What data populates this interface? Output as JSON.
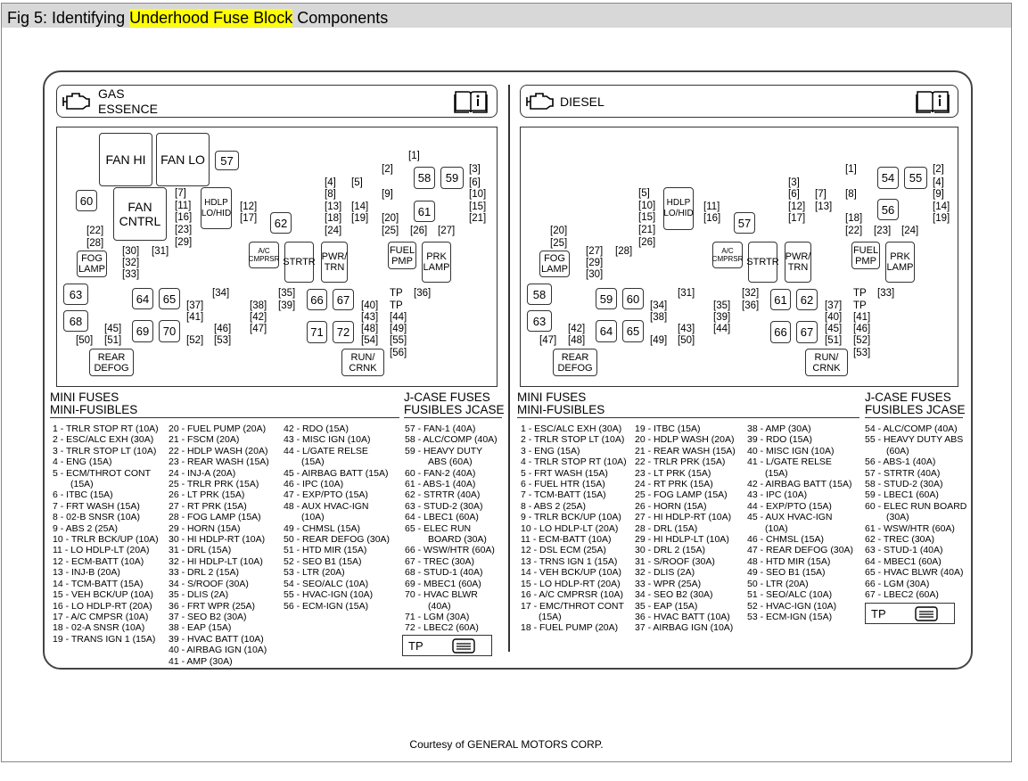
{
  "figure_title": {
    "prefix": "Fig 5: Identifying",
    "highlight": "Underhood Fuse Block",
    "suffix": "Components"
  },
  "gas": {
    "label_line1": "GAS",
    "label_line2": "ESSENCE",
    "mini_fuses_heading": [
      "MINI FUSES",
      "MINI-FUSIBLES"
    ],
    "jcase_heading": [
      "J-CASE FUSES",
      "FUSIBLES JCASE"
    ],
    "mini_col1": [
      "1 - TRLR STOP RT (10A)",
      "2 - ESC/ALC EXH (30A)",
      "3 - TRLR STOP LT (10A)",
      "4 - ENG (15A)",
      "5 - ECM/THROT CONT",
      "(15A)",
      "6 - ITBC (15A)",
      "7 - FRT WASH (15A)",
      "8 - 02-B SNSR (10A)",
      "9 - ABS 2 (25A)",
      "10 - TRLR BCK/UP (10A)",
      "11 - LO HDLP-LT (20A)",
      "12 - ECM-BATT (10A)",
      "13 - INJ-B (20A)",
      "14 - TCM-BATT (15A)",
      "15 - VEH BCK/UP (10A)",
      "16 - LO HDLP-RT (20A)",
      "17 - A/C CMPSR (10A)",
      "18 - 02-A SNSR (10A)",
      "19 - TRANS IGN 1 (15A)"
    ],
    "mini_col2": [
      "20 - FUEL PUMP (20A)",
      "21 - FSCM (20A)",
      "22 - HDLP WASH (20A)",
      "23 - REAR WASH (15A)",
      "24 - INJ-A (20A)",
      "25 - TRLR PRK (15A)",
      "26 - LT PRK (15A)",
      "27 - RT PRK (15A)",
      "28 - FOG LAMP (15A)",
      "29 - HORN (15A)",
      "30 - HI HDLP-RT (10A)",
      "31 - DRL (15A)",
      "32 - HI HDLP-LT (10A)",
      "33 - DRL 2 (15A)",
      "34 - S/ROOF (30A)",
      "35 - DLIS (2A)",
      "36 - FRT WPR (25A)",
      "37 - SEO B2 (30A)",
      "38 - EAP (15A)",
      "39 - HVAC BATT (10A)",
      "40 - AIRBAG IGN (10A)",
      "41 - AMP (30A)"
    ],
    "mini_col3": [
      "42 - RDO (15A)",
      "43 - MISC IGN (10A)",
      "44 - L/GATE RELSE",
      "(15A)",
      "45 - AIRBAG BATT (15A)",
      "46 - IPC (10A)",
      "47 - EXP/PTO (15A)",
      "48 - AUX HVAC-IGN",
      "(10A)",
      "49 - CHMSL (15A)",
      "50 - REAR DEFOG (30A)",
      "51 - HTD MIR (15A)",
      "52 - SEO B1 (15A)",
      "53 - LTR (20A)",
      "54 - SEO/ALC (10A)",
      "55 - HVAC-IGN (10A)",
      "56 - ECM-IGN (15A)"
    ],
    "jcase_col": [
      "57 - FAN-1 (40A)",
      "58 - ALC/COMP (40A)",
      "59 - HEAVY DUTY",
      "ABS (60A)",
      "60 - FAN-2 (40A)",
      "61 - ABS-1 (40A)",
      "62 - STRTR (40A)",
      "63 - STUD-2 (30A)",
      "64 - LBEC1 (60A)",
      "65 - ELEC RUN",
      "BOARD (30A)",
      "66 - WSW/HTR (60A)",
      "67 - TREC (30A)",
      "68 - STUD-1 (40A)",
      "69 - MBEC1 (60A)",
      "70 - HVAC BLWR",
      "(40A)",
      "71 - LGM (30A)",
      "72 - LBEC2 (60A)"
    ],
    "tp_label": "TP",
    "fuses": [
      {
        "t": "FAN HI"
      },
      {
        "t": "FAN LO"
      },
      {
        "t": "57"
      },
      {
        "t": "60"
      },
      {
        "t": "FAN CNTRL"
      },
      {
        "t": "HDLP LO/HID"
      },
      {
        "t": "62"
      },
      {
        "t": "58"
      },
      {
        "t": "59"
      },
      {
        "t": "61"
      },
      {
        "t": "A/C CMPRSR"
      },
      {
        "t": "STRTR"
      },
      {
        "t": "PWR/ TRN"
      },
      {
        "t": "FUEL PMP"
      },
      {
        "t": "PRK LAMP"
      },
      {
        "t": "FOG LAMP"
      },
      {
        "t": "63"
      },
      {
        "t": "68"
      },
      {
        "t": "64"
      },
      {
        "t": "65"
      },
      {
        "t": "69"
      },
      {
        "t": "70"
      },
      {
        "t": "66"
      },
      {
        "t": "67"
      },
      {
        "t": "71"
      },
      {
        "t": "72"
      },
      {
        "t": "REAR DEFOG"
      },
      {
        "t": "RUN/ CRNK"
      }
    ],
    "labels": [
      "[1]",
      "[2]",
      "[3]",
      "[4]",
      "[5]",
      "[6]",
      "[7]",
      "[8]",
      "[9]",
      "[10]",
      "[11]",
      "[12]",
      "[13]",
      "[14]",
      "[15]",
      "[16]",
      "[17]",
      "[18]",
      "[19]",
      "[20]",
      "[21]",
      "[22]",
      "[23]",
      "[24]",
      "[25]",
      "[26]",
      "[27]",
      "[28]",
      "[29]",
      "[30]",
      "[31]",
      "[32]",
      "[33]",
      "[34]",
      "[35]",
      "[36]",
      "[37]",
      "[38]",
      "[39]",
      "[40]",
      "[41]",
      "[42]",
      "[43]",
      "[44]",
      "[45]",
      "[46]",
      "[47]",
      "[48]",
      "[49]",
      "[50]",
      "[51]",
      "[52]",
      "[53]",
      "[54]",
      "[55]",
      "[56]",
      "TP"
    ]
  },
  "diesel": {
    "label": "DIESEL",
    "mini_fuses_heading": [
      "MINI FUSES",
      "MINI-FUSIBLES"
    ],
    "jcase_heading": [
      "J-CASE FUSES",
      "FUSIBLES JCASE"
    ],
    "mini_col1": [
      "1 - ESC/ALC EXH (30A)",
      "2 - TRLR STOP LT (10A)",
      "3 - ENG (15A)",
      "4 - TRLR STOP RT (10A)",
      "5 - FRT WASH (15A)",
      "6 - FUEL HTR (15A)",
      "7 - TCM-BATT (15A)",
      "8 - ABS 2 (25A)",
      "9 - TRLR BCK/UP (10A)",
      "10 - LO HDLP-LT (20A)",
      "11 - ECM-BATT (10A)",
      "12 - DSL ECM (25A)",
      "13 - TRNS IGN 1 (15A)",
      "14 - VEH BCK/UP (10A)",
      "15 - LO HDLP-RT (20A)",
      "16 - A/C CMPRSR (10A)",
      "17 - EMC/THROT CONT",
      "(15A)",
      "18 - FUEL PUMP (20A)"
    ],
    "mini_col2": [
      "19 - ITBC (15A)",
      "20 - HDLP WASH (20A)",
      "21 - REAR WASH (15A)",
      "22 - TRLR PRK (15A)",
      "23 - LT PRK (15A)",
      "24 - RT PRK (15A)",
      "25 - FOG LAMP (15A)",
      "26 - HORN (15A)",
      "27 - HI HDLP-RT (10A)",
      "28 - DRL (15A)",
      "29 - HI HDLP-LT (10A)",
      "30 - DRL 2 (15A)",
      "31 - S/ROOF (30A)",
      "32 - DLIS (2A)",
      "33 - WPR (25A)",
      "34 - SEO B2 (30A)",
      "35 - EAP (15A)",
      "36 - HVAC BATT (10A)",
      "37 - AIRBAG IGN (10A)"
    ],
    "mini_col3": [
      "38 - AMP (30A)",
      "39 - RDO (15A)",
      "40 - MISC IGN (10A)",
      "41 - L/GATE RELSE",
      "(15A)",
      "42 - AIRBAG BATT (15A)",
      "43 - IPC (10A)",
      "44 - EXP/PTO (15A)",
      "45 - AUX HVAC-IGN",
      "(10A)",
      "46 - CHMSL (15A)",
      "47 - REAR DEFOG (30A)",
      "48 - HTD MIR (15A)",
      "49 - SEO B1 (15A)",
      "50 - LTR (20A)",
      "51 - SEO/ALC (10A)",
      "52 - HVAC-IGN (10A)",
      "53 - ECM-IGN (15A)"
    ],
    "jcase_col": [
      "54 - ALC/COMP (40A)",
      "55 - HEAVY DUTY ABS",
      "(60A)",
      "56 - ABS-1 (40A)",
      "57 - STRTR (40A)",
      "58 - STUD-2 (30A)",
      "59 - LBEC1 (60A)",
      "60 - ELEC RUN BOARD",
      "(30A)",
      "61 - WSW/HTR (60A)",
      "62 - TREC (30A)",
      "63 - STUD-1 (40A)",
      "64 - MBEC1 (60A)",
      "65 - HVAC BLWR (40A)",
      "66 - LGM (30A)",
      "67 - LBEC2 (60A)"
    ],
    "tp_label": "TP",
    "fuses": [
      {
        "t": "HDLP LO/HID"
      },
      {
        "t": "57"
      },
      {
        "t": "54"
      },
      {
        "t": "55"
      },
      {
        "t": "56"
      },
      {
        "t": "A/C CMPRSR"
      },
      {
        "t": "STRTR"
      },
      {
        "t": "PWR/ TRN"
      },
      {
        "t": "FUEL PMP"
      },
      {
        "t": "PRK LAMP"
      },
      {
        "t": "FOG LAMP"
      },
      {
        "t": "58"
      },
      {
        "t": "59"
      },
      {
        "t": "60"
      },
      {
        "t": "61"
      },
      {
        "t": "62"
      },
      {
        "t": "63"
      },
      {
        "t": "64"
      },
      {
        "t": "65"
      },
      {
        "t": "66"
      },
      {
        "t": "67"
      },
      {
        "t": "REAR DEFOG"
      },
      {
        "t": "RUN/ CRNK"
      }
    ],
    "labels": [
      "[1]",
      "[2]",
      "[3]",
      "[4]",
      "[5]",
      "[6]",
      "[7]",
      "[8]",
      "[9]",
      "[10]",
      "[11]",
      "[12]",
      "[13]",
      "[14]",
      "[15]",
      "[16]",
      "[17]",
      "[18]",
      "[19]",
      "[20]",
      "[21]",
      "[22]",
      "[23]",
      "[24]",
      "[25]",
      "[26]",
      "[27]",
      "[28]",
      "[29]",
      "[30]",
      "[31]",
      "[32]",
      "[33]",
      "[34]",
      "[35]",
      "[36]",
      "[37]",
      "[38]",
      "[39]",
      "[40]",
      "[41]",
      "[42]",
      "[43]",
      "[44]",
      "[45]",
      "[46]",
      "[47]",
      "[48]",
      "[49]",
      "[50]",
      "[51]",
      "[52]",
      "[53]",
      "TP"
    ]
  },
  "courtesy": "Courtesy of GENERAL MOTORS CORP."
}
